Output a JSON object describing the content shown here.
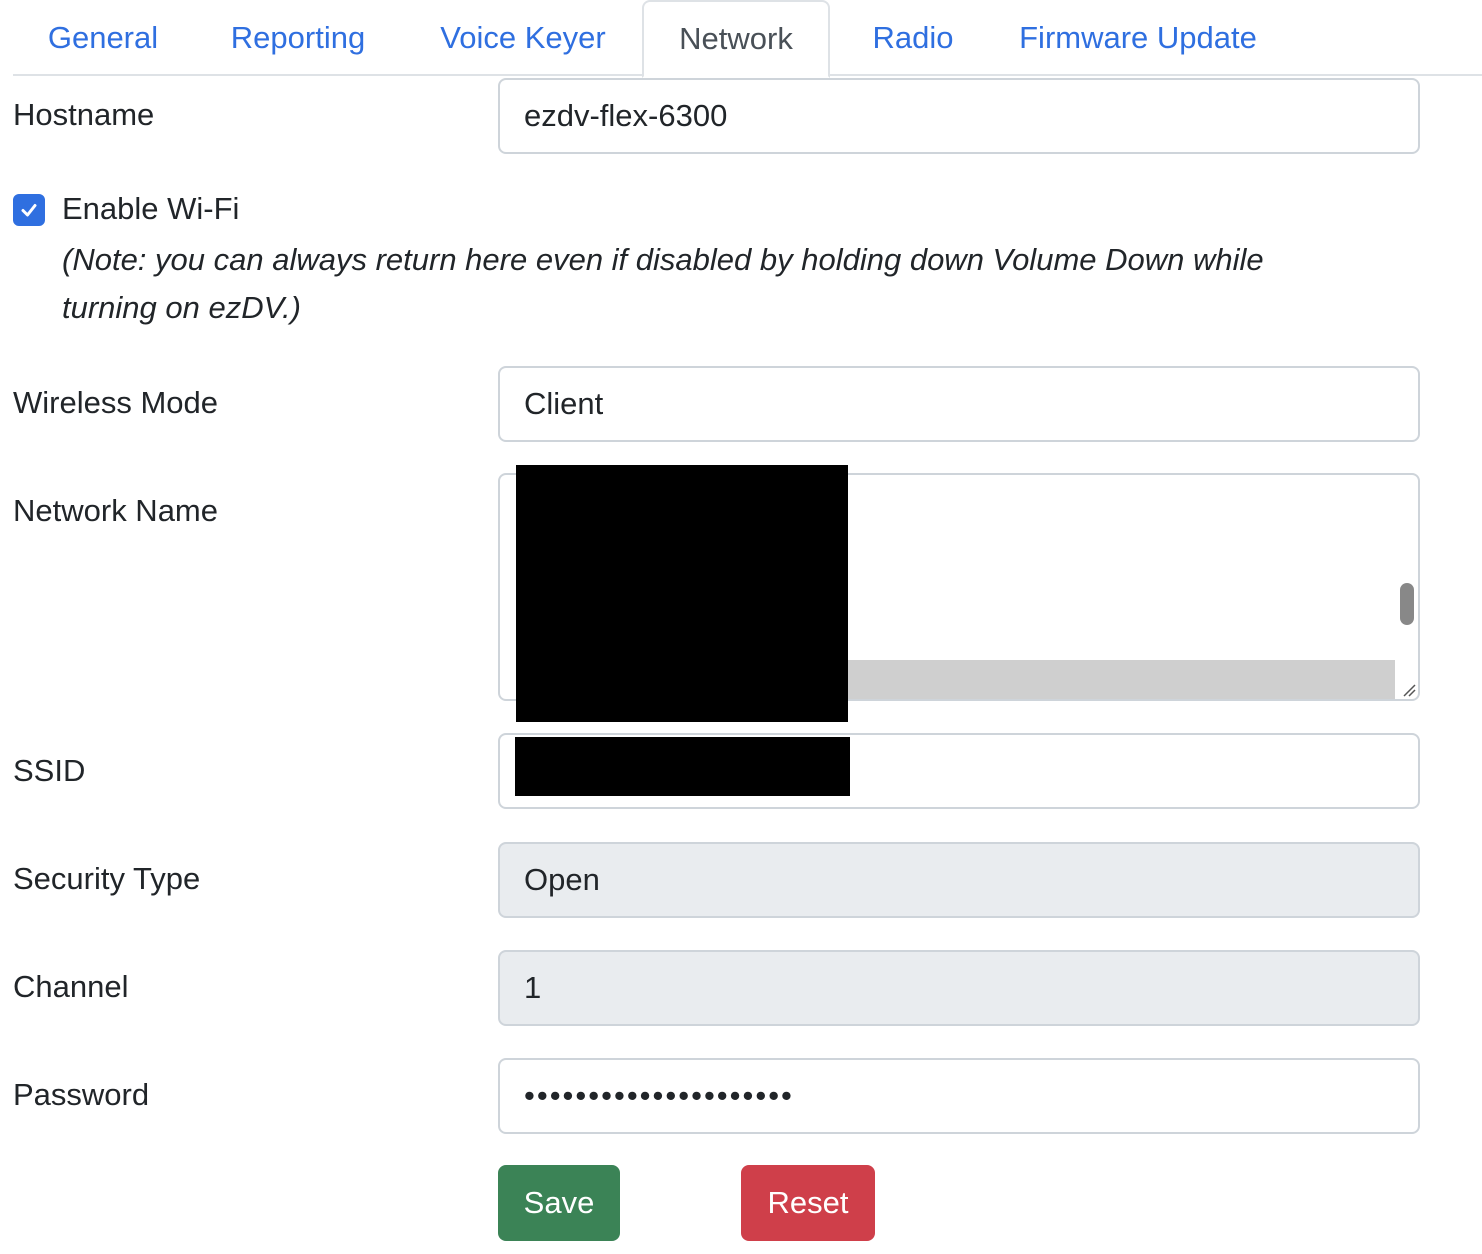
{
  "tabs": [
    {
      "label": "General"
    },
    {
      "label": "Reporting"
    },
    {
      "label": "Voice Keyer"
    },
    {
      "label": "Network"
    },
    {
      "label": "Radio"
    },
    {
      "label": "Firmware Update"
    }
  ],
  "active_tab": "Network",
  "form": {
    "hostname": {
      "label": "Hostname",
      "value": "ezdv-flex-6300"
    },
    "enable_wifi": {
      "label": "Enable Wi-Fi",
      "checked": true,
      "note": "(Note: you can always return here even if disabled by holding down Volume Down while turning on ezDV.)"
    },
    "wireless_mode": {
      "label": "Wireless Mode",
      "value": "Client"
    },
    "network_name": {
      "label": "Network Name"
    },
    "ssid": {
      "label": "SSID"
    },
    "security_type": {
      "label": "Security Type",
      "value": "Open"
    },
    "channel": {
      "label": "Channel",
      "value": "1"
    },
    "password": {
      "label": "Password",
      "value": "•••••••••••••••••••••"
    }
  },
  "buttons": {
    "save": "Save",
    "reset": "Reset"
  },
  "colors": {
    "accent": "#2f6fe0",
    "save": "#3b8356",
    "reset": "#cf3f4a",
    "disabled_bg": "#e9ecef"
  }
}
